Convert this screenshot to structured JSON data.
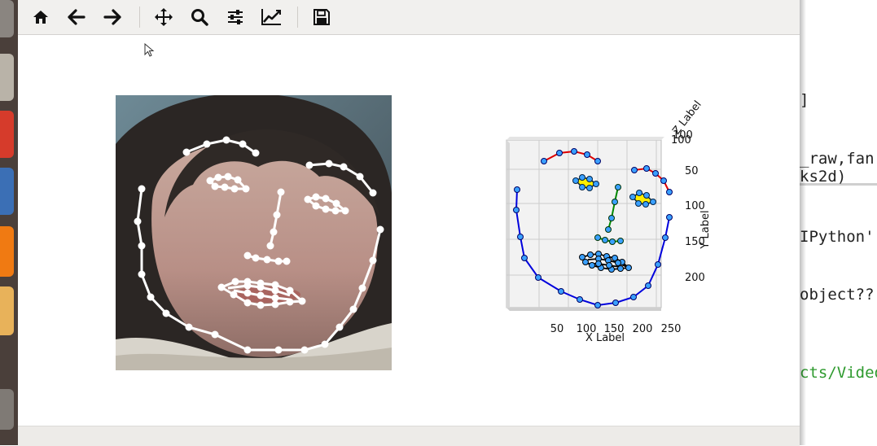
{
  "window": {
    "toolbar": {
      "home_tooltip": "Home",
      "back_tooltip": "Back",
      "forward_tooltip": "Forward",
      "pan_tooltip": "Pan",
      "zoom_tooltip": "Zoom",
      "subplots_tooltip": "Configure subplots",
      "axes_tooltip": "Edit axis",
      "save_tooltip": "Save"
    }
  },
  "plot3d": {
    "xlabel": "X Label",
    "ylabel": "Y Label",
    "zlabel": "Z Label",
    "xticks": [
      "50",
      "100",
      "150",
      "200",
      "250"
    ],
    "yticks": [
      "50",
      "100",
      "150",
      "200"
    ],
    "zticks_cluster": "100"
  },
  "terminal": {
    "lines": [
      {
        "text": "]",
        "color": "#222222"
      },
      {
        "text": "_raw,fan",
        "color": "#222222"
      },
      {
        "text": "ks2d)",
        "color": "#222222"
      },
      {
        "text": "IPython'",
        "color": "#222222"
      },
      {
        "text": "object??",
        "color": "#222222"
      },
      {
        "text": "cts/Video",
        "color": "#2e9a2e"
      }
    ]
  },
  "colors": {
    "launcher_bg": "#4a3f3a",
    "toolbar_bg": "#f1f0ee",
    "jaw_line": "#0000dd",
    "brow_line": "#dd0000",
    "nose_line": "#008800",
    "eye_fill": "#ffee00",
    "lip_line": "#000000",
    "marker_fill": "#3aa0ff"
  }
}
